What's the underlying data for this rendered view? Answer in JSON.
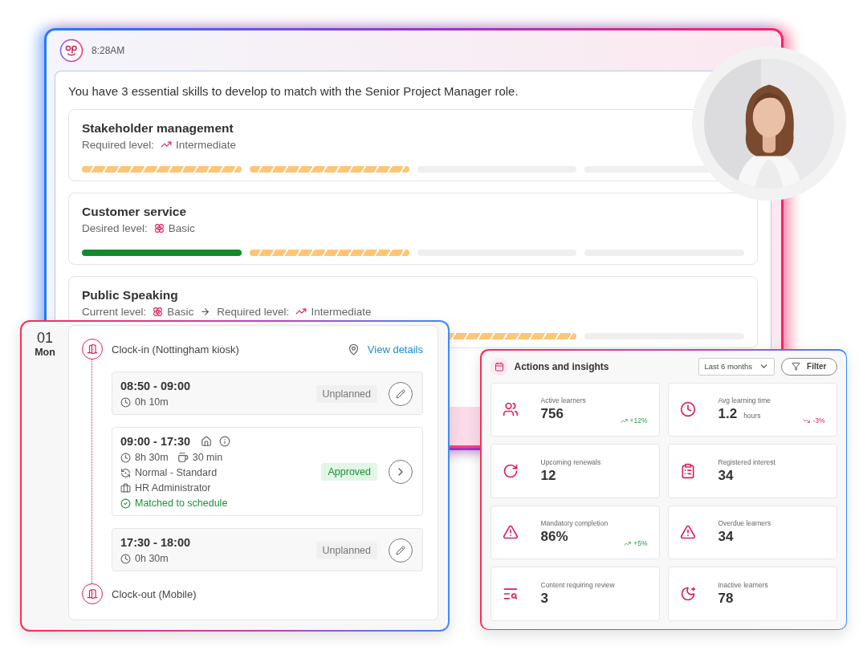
{
  "chat": {
    "time": "8:28AM",
    "message": "You have 3 essential skills to develop to match with the Senior Project Manager role.",
    "skills": [
      {
        "title": "Stakeholder management",
        "levels": [
          {
            "label": "Required level:",
            "value": "Intermediate",
            "kind": "intermediate"
          }
        ],
        "segments": [
          {
            "kind": "progress"
          },
          {
            "kind": "progress"
          },
          {
            "kind": "empty"
          },
          {
            "kind": "empty"
          }
        ]
      },
      {
        "title": "Customer service",
        "levels": [
          {
            "label": "Desired level:",
            "value": "Basic",
            "kind": "basic"
          }
        ],
        "segments": [
          {
            "kind": "done"
          },
          {
            "kind": "progress"
          },
          {
            "kind": "empty"
          },
          {
            "kind": "empty"
          }
        ]
      },
      {
        "title": "Public Speaking",
        "levels": [
          {
            "label": "Current level:",
            "value": "Basic",
            "kind": "basic"
          },
          {
            "label": "Required level:",
            "value": "Intermediate",
            "kind": "intermediate"
          }
        ],
        "segments": [
          {
            "kind": "progress"
          },
          {
            "kind": "empty"
          }
        ]
      }
    ]
  },
  "timesheet": {
    "day_number": "01",
    "day_name": "Mon",
    "clock_in": {
      "label": "Clock-in (Nottingham kiosk)",
      "link": "View details"
    },
    "shifts": [
      {
        "time": "08:50 - 09:00",
        "duration": "0h 10m",
        "status": {
          "text": "Unplanned",
          "kind": "unplanned"
        }
      },
      {
        "time": "09:00 - 17:30",
        "duration": "8h 30m",
        "break": "30 min",
        "rule": "Normal - Standard",
        "role": "HR Administrator",
        "match": "Matched to schedule",
        "status": {
          "text": "Approved",
          "kind": "approved"
        }
      },
      {
        "time": "17:30 - 18:00",
        "duration": "0h 30m",
        "status": {
          "text": "Unplanned",
          "kind": "unplanned"
        }
      }
    ],
    "clock_out": {
      "label": "Clock-out (Mobile)"
    }
  },
  "insights": {
    "title": "Actions and insights",
    "period": "Last 6 months",
    "filter": "Filter",
    "metrics": [
      {
        "label": "Active learners",
        "value": "756",
        "trend": {
          "text": "+12%",
          "kind": "up"
        }
      },
      {
        "label": "Avg learning time",
        "value": "1.2",
        "unit": "hours",
        "trend": {
          "text": "-3%",
          "kind": "down"
        }
      },
      {
        "label": "Upcoming renewals",
        "value": "12"
      },
      {
        "label": "Registered interest",
        "value": "34"
      },
      {
        "label": "Mandatory completion",
        "value": "86%",
        "trend": {
          "text": "+5%",
          "kind": "up"
        }
      },
      {
        "label": "Overdue learners",
        "value": "34"
      },
      {
        "label": "Content requiring review",
        "value": "3"
      },
      {
        "label": "Inactive learners",
        "value": "78"
      }
    ]
  }
}
